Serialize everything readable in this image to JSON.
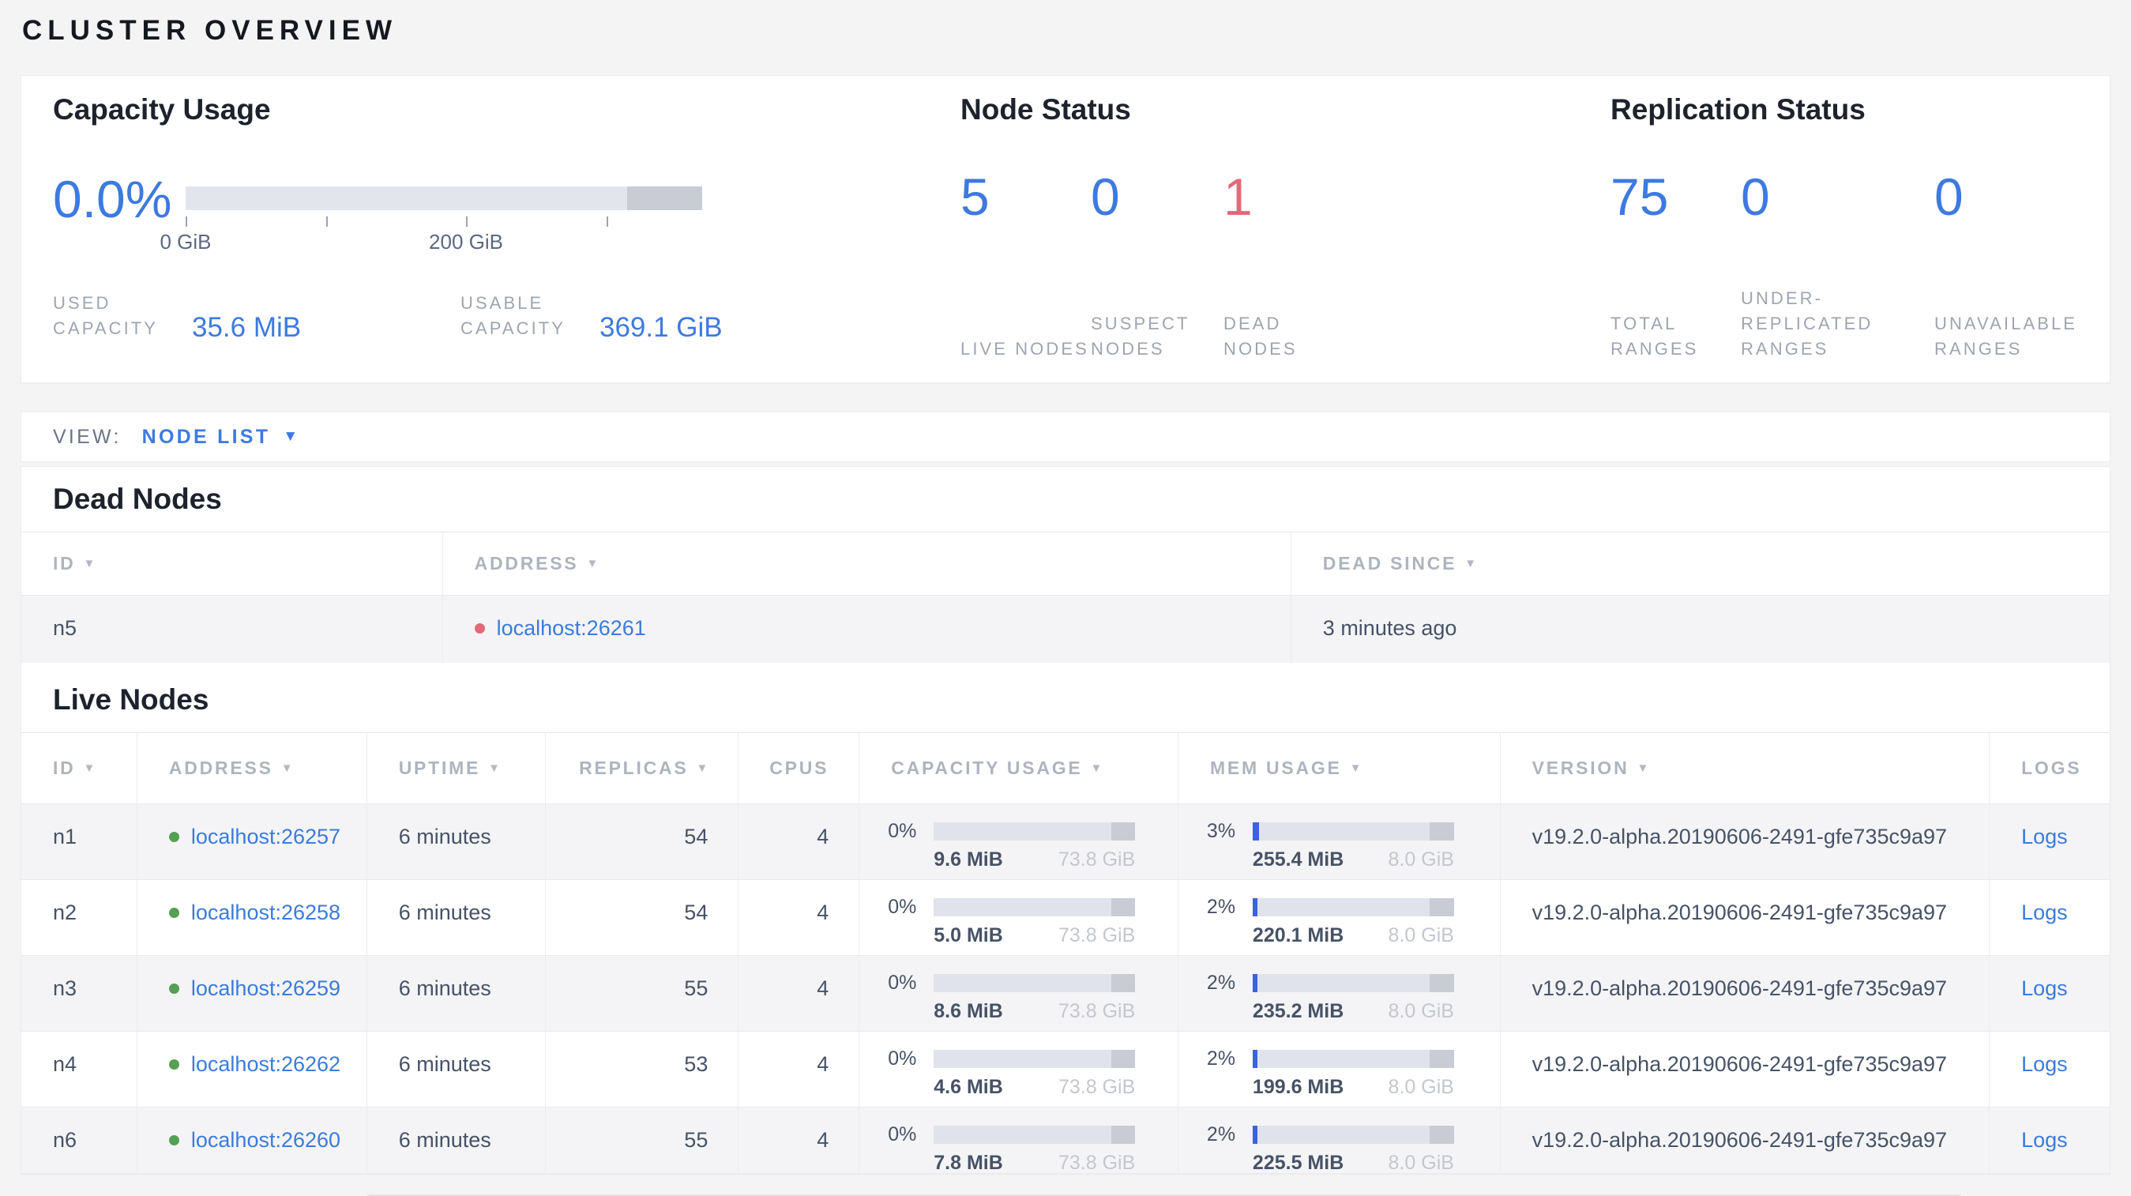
{
  "page": {
    "title": "CLUSTER OVERVIEW"
  },
  "colors": {
    "accent_blue": "#3d7ae0",
    "danger_red": "#e06a79",
    "live_green": "#55a053",
    "link_blue": "#3b7bdb"
  },
  "summary": {
    "capacity": {
      "title": "Capacity Usage",
      "percent": "0.0%",
      "bar": {
        "used_fraction": 0,
        "dark_segment_start_fraction": 0.855,
        "ticks": [
          {
            "fraction": 0.0,
            "label": "0 GiB"
          },
          {
            "fraction": 0.272,
            "label": ""
          },
          {
            "fraction": 0.543,
            "label": "200 GiB"
          },
          {
            "fraction": 0.815,
            "label": ""
          }
        ]
      },
      "used_label": "USED CAPACITY",
      "used_value": "35.6 MiB",
      "usable_label": "USABLE CAPACITY",
      "usable_value": "369.1 GiB"
    },
    "nodes": {
      "title": "Node Status",
      "stats": [
        {
          "value": "5",
          "label": "LIVE NODES",
          "color": "blue"
        },
        {
          "value": "0",
          "label": "SUSPECT NODES",
          "color": "blue"
        },
        {
          "value": "1",
          "label": "DEAD NODES",
          "color": "red"
        }
      ]
    },
    "replication": {
      "title": "Replication Status",
      "stats": [
        {
          "value": "75",
          "label": "TOTAL RANGES",
          "color": "blue"
        },
        {
          "value": "0",
          "label": "UNDER-REPLICATED RANGES",
          "color": "blue"
        },
        {
          "value": "0",
          "label": "UNAVAILABLE RANGES",
          "color": "blue"
        }
      ]
    }
  },
  "view_bar": {
    "label": "VIEW:",
    "selected": "NODE LIST",
    "caret": "▼"
  },
  "dead_nodes": {
    "heading": "Dead Nodes",
    "columns": [
      {
        "label": "ID",
        "sortable": true
      },
      {
        "label": "ADDRESS",
        "sortable": true
      },
      {
        "label": "DEAD SINCE",
        "sortable": true
      }
    ],
    "rows": [
      {
        "id": "n5",
        "address": "localhost:26261",
        "dead_since": "3 minutes ago"
      }
    ]
  },
  "live_nodes": {
    "heading": "Live Nodes",
    "columns": [
      {
        "label": "ID",
        "sortable": true
      },
      {
        "label": "ADDRESS",
        "sortable": true
      },
      {
        "label": "UPTIME",
        "sortable": true
      },
      {
        "label": "REPLICAS",
        "sortable": true
      },
      {
        "label": "CPUS",
        "sortable": false
      },
      {
        "label": "CAPACITY USAGE",
        "sortable": true
      },
      {
        "label": "MEM USAGE",
        "sortable": true
      },
      {
        "label": "VERSION",
        "sortable": true
      },
      {
        "label": "LOGS",
        "sortable": false
      }
    ],
    "rows": [
      {
        "id": "n1",
        "address": "localhost:26257",
        "uptime": "6 minutes",
        "replicas": "54",
        "cpus": "4",
        "capacity": {
          "percent": "0%",
          "used": "9.6 MiB",
          "total": "73.8 GiB"
        },
        "mem": {
          "percent": "3%",
          "used": "255.4 MiB",
          "total": "8.0 GiB"
        },
        "version": "v19.2.0-alpha.20190606-2491-gfe735c9a97",
        "logs": "Logs"
      },
      {
        "id": "n2",
        "address": "localhost:26258",
        "uptime": "6 minutes",
        "replicas": "54",
        "cpus": "4",
        "capacity": {
          "percent": "0%",
          "used": "5.0 MiB",
          "total": "73.8 GiB"
        },
        "mem": {
          "percent": "2%",
          "used": "220.1 MiB",
          "total": "8.0 GiB"
        },
        "version": "v19.2.0-alpha.20190606-2491-gfe735c9a97",
        "logs": "Logs"
      },
      {
        "id": "n3",
        "address": "localhost:26259",
        "uptime": "6 minutes",
        "replicas": "55",
        "cpus": "4",
        "capacity": {
          "percent": "0%",
          "used": "8.6 MiB",
          "total": "73.8 GiB"
        },
        "mem": {
          "percent": "2%",
          "used": "235.2 MiB",
          "total": "8.0 GiB"
        },
        "version": "v19.2.0-alpha.20190606-2491-gfe735c9a97",
        "logs": "Logs"
      },
      {
        "id": "n4",
        "address": "localhost:26262",
        "uptime": "6 minutes",
        "replicas": "53",
        "cpus": "4",
        "capacity": {
          "percent": "0%",
          "used": "4.6 MiB",
          "total": "73.8 GiB"
        },
        "mem": {
          "percent": "2%",
          "used": "199.6 MiB",
          "total": "8.0 GiB"
        },
        "version": "v19.2.0-alpha.20190606-2491-gfe735c9a97",
        "logs": "Logs"
      },
      {
        "id": "n6",
        "address": "localhost:26260",
        "uptime": "6 minutes",
        "replicas": "55",
        "cpus": "4",
        "capacity": {
          "percent": "0%",
          "used": "7.8 MiB",
          "total": "73.8 GiB"
        },
        "mem": {
          "percent": "2%",
          "used": "225.5 MiB",
          "total": "8.0 GiB"
        },
        "version": "v19.2.0-alpha.20190606-2491-gfe735c9a97",
        "logs": "Logs"
      }
    ]
  }
}
